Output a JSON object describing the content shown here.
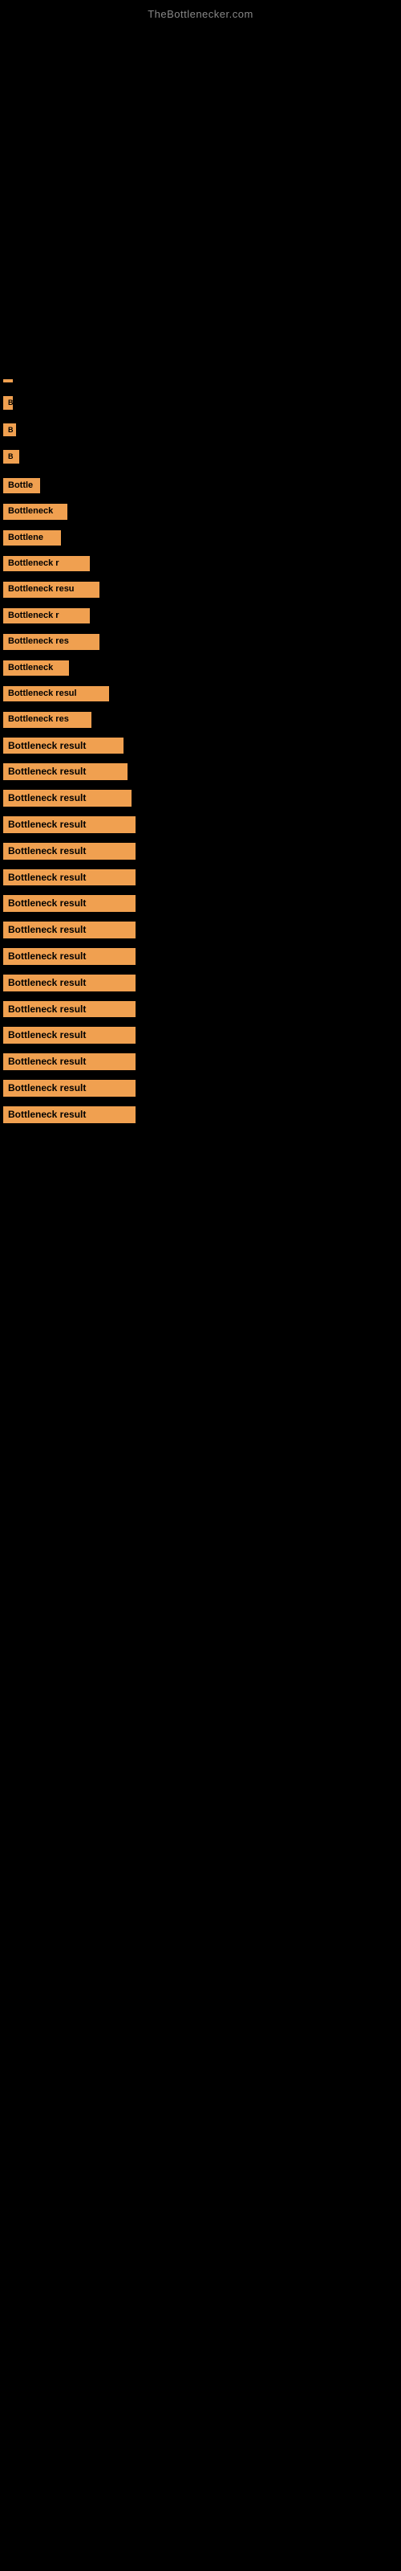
{
  "site": {
    "title": "TheBottlenecker.com"
  },
  "bars": [
    {
      "id": 1,
      "label": ""
    },
    {
      "id": 2,
      "label": "B"
    },
    {
      "id": 3,
      "label": "B"
    },
    {
      "id": 4,
      "label": "B"
    },
    {
      "id": 5,
      "label": "Bottle"
    },
    {
      "id": 6,
      "label": "Bottleneck"
    },
    {
      "id": 7,
      "label": "Bottlene"
    },
    {
      "id": 8,
      "label": "Bottleneck r"
    },
    {
      "id": 9,
      "label": "Bottleneck resu"
    },
    {
      "id": 10,
      "label": "Bottleneck r"
    },
    {
      "id": 11,
      "label": "Bottleneck res"
    },
    {
      "id": 12,
      "label": "Bottleneck"
    },
    {
      "id": 13,
      "label": "Bottleneck resul"
    },
    {
      "id": 14,
      "label": "Bottleneck res"
    },
    {
      "id": 15,
      "label": "Bottleneck result"
    },
    {
      "id": 16,
      "label": "Bottleneck result"
    },
    {
      "id": 17,
      "label": "Bottleneck result"
    },
    {
      "id": 18,
      "label": "Bottleneck result"
    },
    {
      "id": 19,
      "label": "Bottleneck result"
    },
    {
      "id": 20,
      "label": "Bottleneck result"
    },
    {
      "id": 21,
      "label": "Bottleneck result"
    },
    {
      "id": 22,
      "label": "Bottleneck result"
    },
    {
      "id": 23,
      "label": "Bottleneck result"
    },
    {
      "id": 24,
      "label": "Bottleneck result"
    },
    {
      "id": 25,
      "label": "Bottleneck result"
    },
    {
      "id": 26,
      "label": "Bottleneck result"
    },
    {
      "id": 27,
      "label": "Bottleneck result"
    },
    {
      "id": 28,
      "label": "Bottleneck result"
    },
    {
      "id": 29,
      "label": "Bottleneck result"
    }
  ]
}
